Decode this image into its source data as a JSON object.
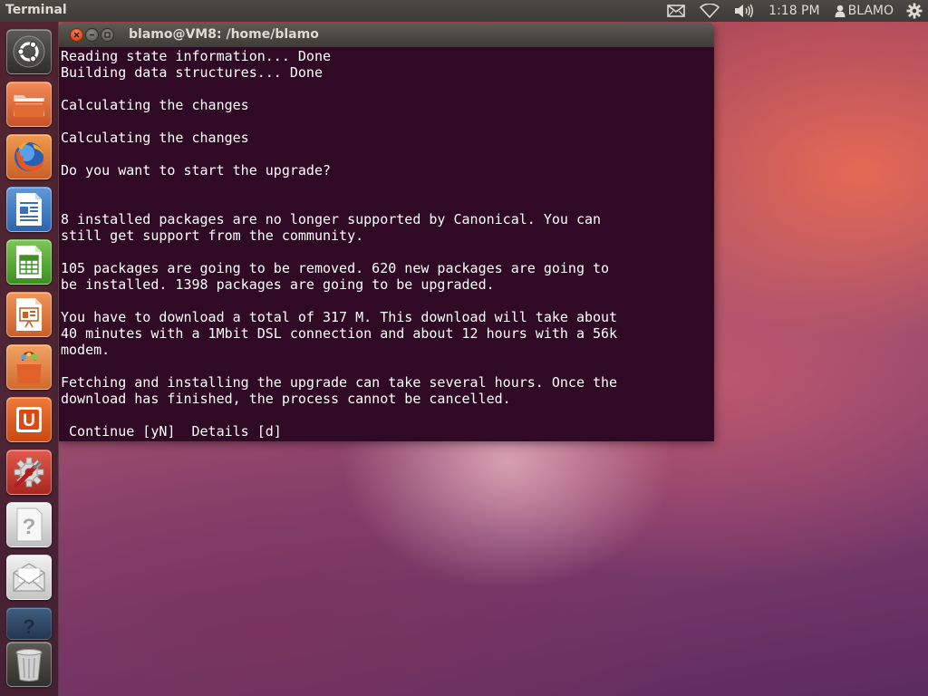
{
  "top_panel": {
    "app_title": "Terminal",
    "clock": "1:18 PM",
    "user_name": "BLAMO",
    "icons": [
      "mail-icon",
      "wifi-icon",
      "volume-icon",
      "user-icon",
      "gear-icon"
    ]
  },
  "launcher": {
    "items": [
      {
        "name": "dash-home",
        "icon": "ubuntu-logo-icon"
      },
      {
        "name": "home-folder",
        "icon": "folder-icon"
      },
      {
        "name": "firefox",
        "icon": "firefox-icon"
      },
      {
        "name": "libreoffice-writer",
        "icon": "writer-icon"
      },
      {
        "name": "libreoffice-calc",
        "icon": "calc-icon"
      },
      {
        "name": "libreoffice-impress",
        "icon": "impress-icon"
      },
      {
        "name": "software-center",
        "icon": "shopping-bag-icon"
      },
      {
        "name": "ubuntu-one",
        "icon": "ubuntu-one-icon"
      },
      {
        "name": "system-settings",
        "icon": "settings-icon"
      },
      {
        "name": "help",
        "icon": "question-icon"
      },
      {
        "name": "mail-app",
        "icon": "envelope-icon"
      },
      {
        "name": "help-faded",
        "icon": "question-icon"
      },
      {
        "name": "trash",
        "icon": "trash-icon"
      }
    ],
    "labels": {
      "help_glyph": "?",
      "ubuntu_one_glyph": "U"
    }
  },
  "terminal": {
    "title": "blamo@VM8: /home/blamo",
    "lines": [
      "Reading state information... Done",
      "Building data structures... Done",
      "",
      "Calculating the changes",
      "",
      "Calculating the changes",
      "",
      "Do you want to start the upgrade?",
      "",
      "",
      "8 installed packages are no longer supported by Canonical. You can",
      "still get support from the community.",
      "",
      "105 packages are going to be removed. 620 new packages are going to",
      "be installed. 1398 packages are going to be upgraded.",
      "",
      "You have to download a total of 317 M. This download will take about",
      "40 minutes with a 1Mbit DSL connection and about 12 hours with a 56k",
      "modem.",
      "",
      "Fetching and installing the upgrade can take several hours. Once the",
      "download has finished, the process cannot be cancelled.",
      "",
      " Continue [yN]  Details [d]"
    ]
  },
  "colors": {
    "terminal_background": "#300a24",
    "terminal_text": "#ffffff",
    "panel_background": "#3c3b37",
    "close_button": "#dd4814"
  }
}
